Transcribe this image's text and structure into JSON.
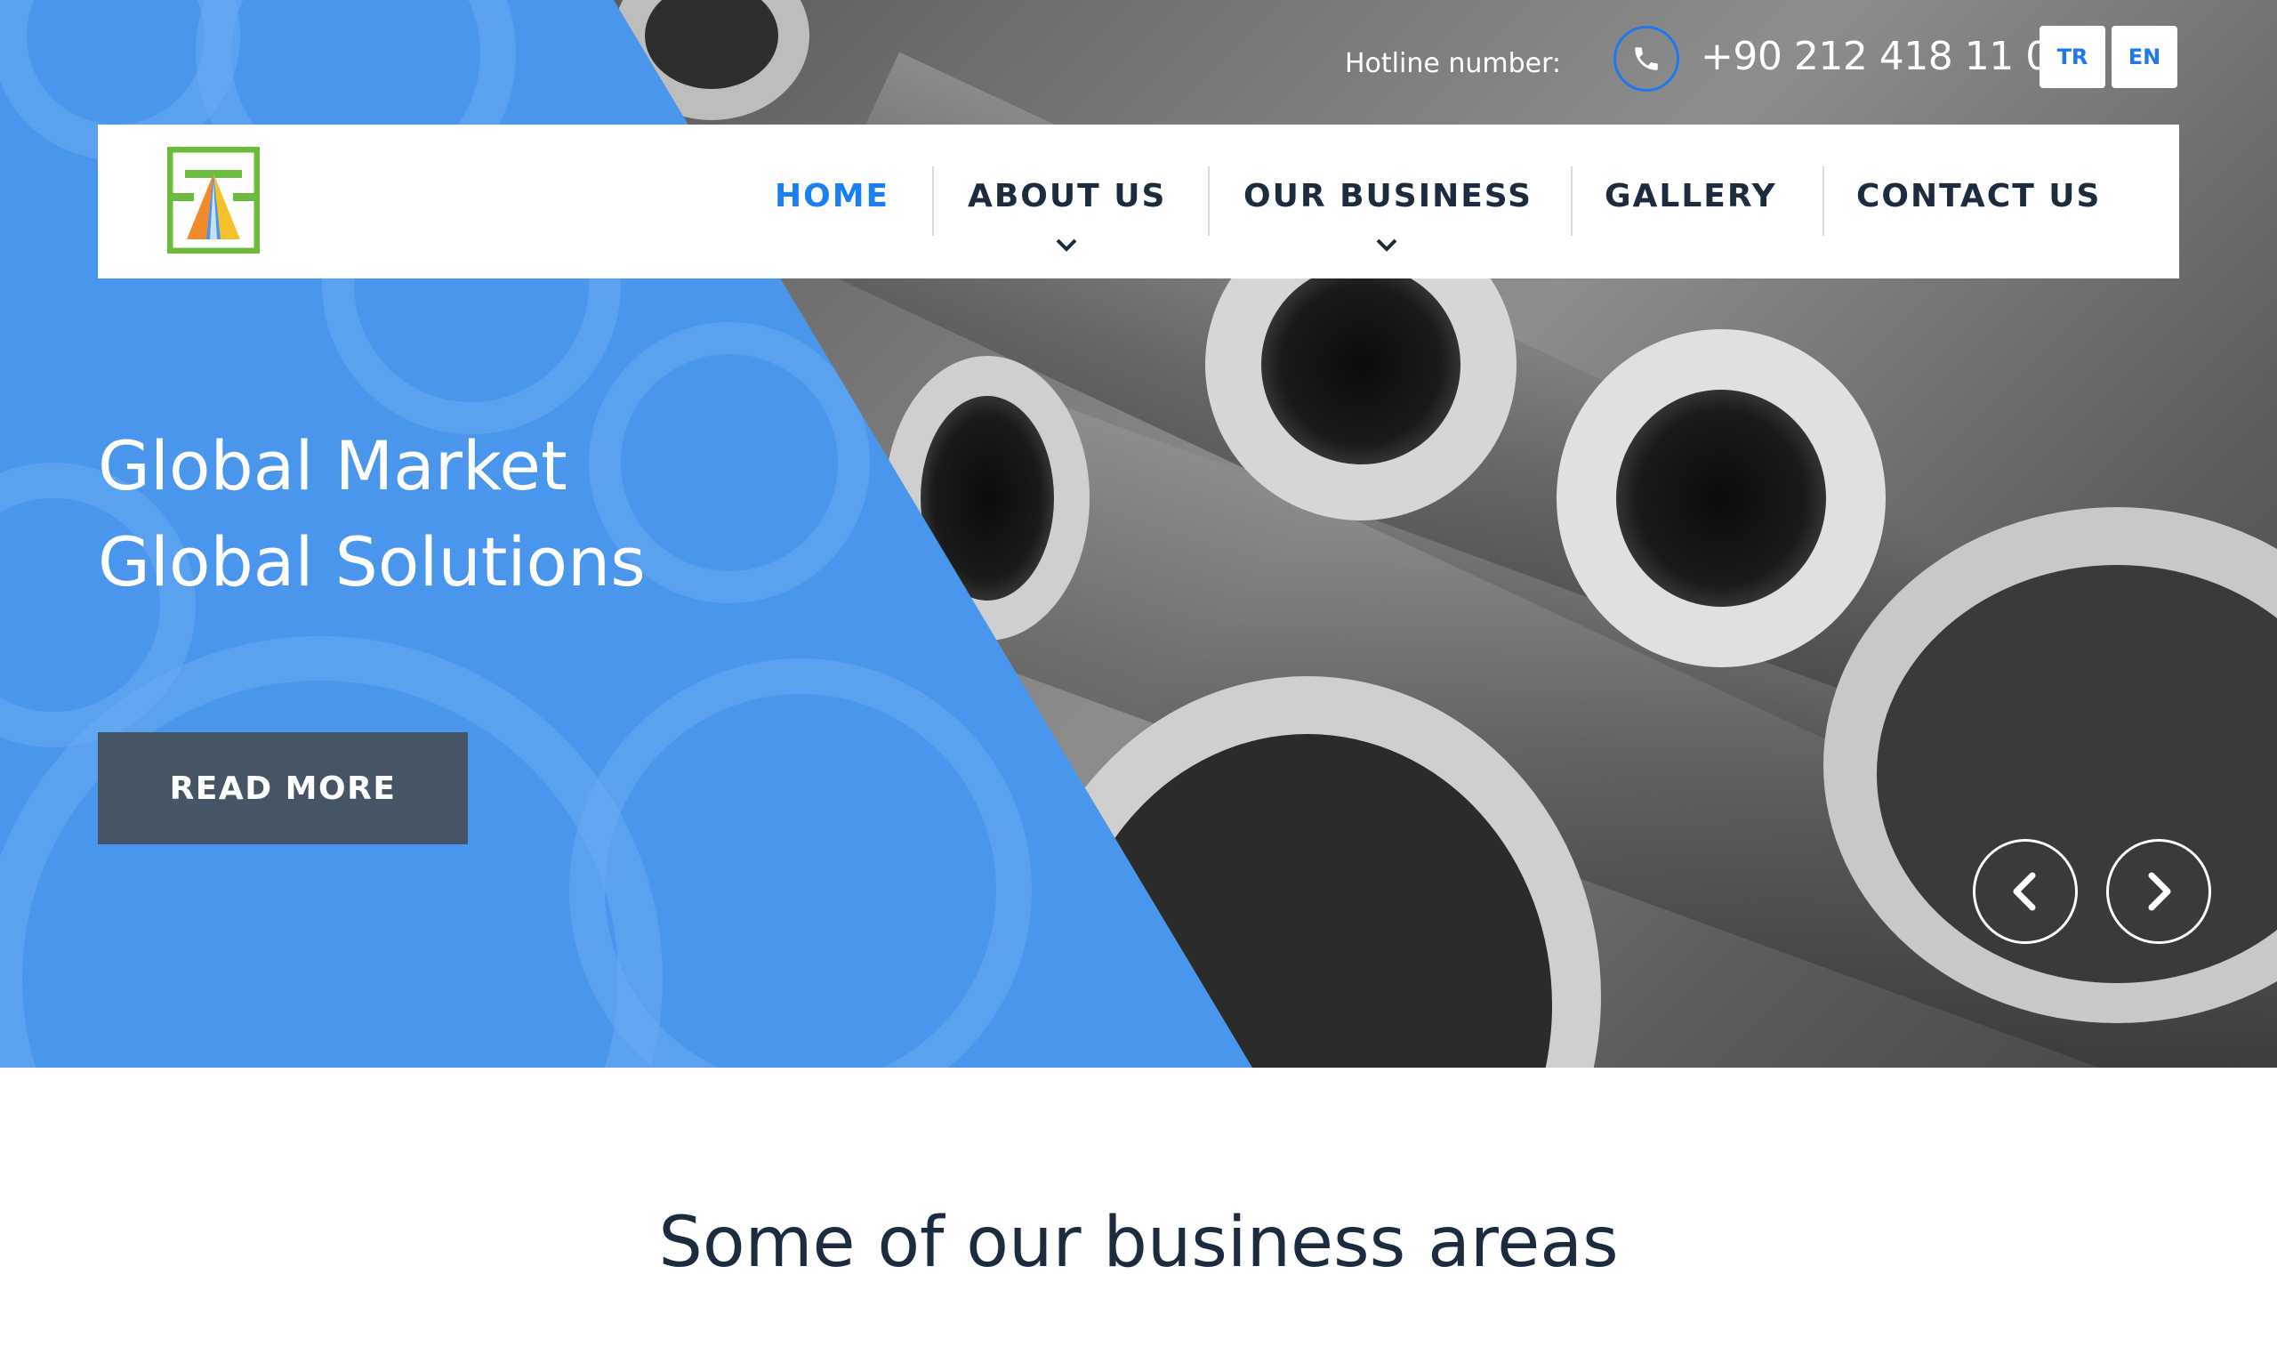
{
  "header": {
    "hotline_label": "Hotline number:",
    "phone_number": "+90 212 418 11 00",
    "languages": [
      "TR",
      "EN"
    ]
  },
  "nav": {
    "items": [
      {
        "label": "HOME",
        "active": true,
        "has_dropdown": false
      },
      {
        "label": "ABOUT US",
        "active": false,
        "has_dropdown": true
      },
      {
        "label": "OUR BUSINESS",
        "active": false,
        "has_dropdown": true
      },
      {
        "label": "GALLERY",
        "active": false,
        "has_dropdown": false
      },
      {
        "label": "CONTACT US",
        "active": false,
        "has_dropdown": false
      }
    ]
  },
  "hero": {
    "title_line1": "Global Market",
    "title_line2": "Global Solutions",
    "cta_label": "READ MORE"
  },
  "section": {
    "title": "Some of our business areas"
  },
  "colors": {
    "accent_blue": "#1a7ff0",
    "hero_blue": "#4a96ec",
    "nav_text": "#1c2b3d",
    "button_dark": "#455565"
  },
  "icons": {
    "phone": "phone-icon",
    "prev": "chevron-left-icon",
    "next": "chevron-right-icon",
    "dropdown": "chevron-down-icon",
    "logo": "company-logo"
  }
}
